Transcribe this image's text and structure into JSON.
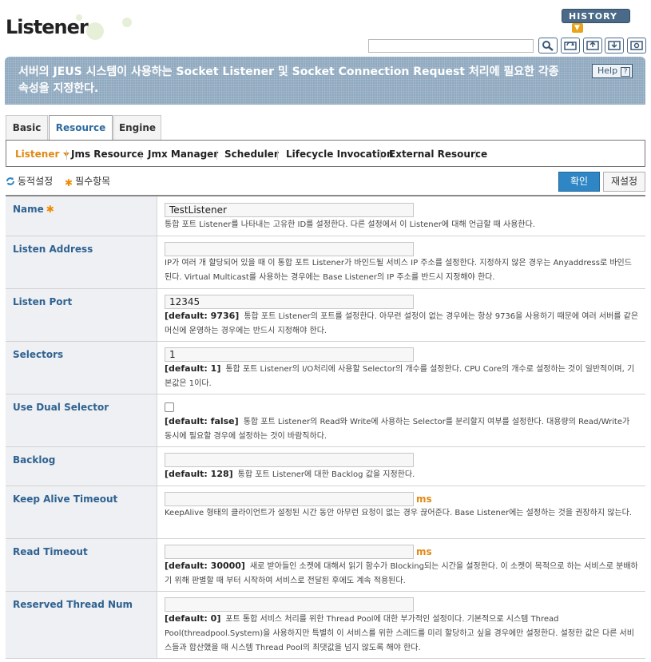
{
  "header": {
    "title": "Listener",
    "history_label": "HISTORY",
    "search_value": "",
    "tools": [
      "search-icon",
      "refresh-icon",
      "xml-export-icon",
      "xml-import-icon",
      "settings-icon"
    ]
  },
  "banner": {
    "text": "서버의 JEUS 시스템이 사용하는 Socket Listener 및 Socket Connection Request 처리에 필요한 각종 속성을 지정한다.",
    "help_label": "Help",
    "help_icon_text": "?"
  },
  "tabs": [
    {
      "label": "Basic",
      "active": false
    },
    {
      "label": "Resource",
      "active": true
    },
    {
      "label": "Engine",
      "active": false
    }
  ],
  "subnav": [
    {
      "label": "Listener",
      "active": true
    },
    {
      "label": "Jms Resource",
      "active": false
    },
    {
      "label": "Jmx Manager",
      "active": false
    },
    {
      "label": "Scheduler",
      "active": false
    },
    {
      "label": "Lifecycle Invocation",
      "active": false
    },
    {
      "label": "External Resource",
      "active": false
    }
  ],
  "legend": {
    "dynamic_label": "동적설정",
    "required_label": "필수항목",
    "required_mark": "✱"
  },
  "actions": {
    "ok_label": "확인",
    "reset_label": "재설정"
  },
  "fields": [
    {
      "label": "Name",
      "required": true,
      "value": "TestListener",
      "unit": "",
      "default": "",
      "desc": "통합 포트 Listener를 나타내는 고유한 ID를 설정한다. 다른 설정에서 이 Listener에 대해 언급할 때 사용한다."
    },
    {
      "label": "Listen Address",
      "required": false,
      "value": "",
      "unit": "",
      "default": "",
      "desc": "IP가 여러 개 할당되어 있을 때 이 통합 포트 Listener가 바인드될 서비스 IP 주소를 설정한다. 지정하지 않은 경우는 Anyaddress로 바인드된다. Virtual Multicast를 사용하는 경우에는 Base Listener의 IP 주소를 반드시 지정해야 한다."
    },
    {
      "label": "Listen Port",
      "required": false,
      "value": "12345",
      "unit": "",
      "default": "[default: 9736]",
      "desc": "통합 포트 Listener의 포트를 설정한다. 아무런 설정이 없는 경우에는 항상 9736을 사용하기 때문에 여러 서버를 같은 머신에 운영하는 경우에는 반드시 지정해야 한다."
    },
    {
      "label": "Selectors",
      "required": false,
      "value": "1",
      "unit": "",
      "default": "[default: 1]",
      "desc": "통합 포트 Listener의 I/O처리에 사용할 Selector의 개수를 설정한다. CPU Core의 개수로 설정하는 것이 일반적이며, 기본값은 1이다."
    },
    {
      "label": "Use Dual Selector",
      "required": false,
      "value": "",
      "unit": "",
      "default": "[default: false]",
      "desc": "통합 포트 Listener의 Read와 Write에 사용하는 Selector를 분리할지 여부를 설정한다. 대용량의 Read/Write가 동시에 필요할 경우에 설정하는 것이 바람직하다."
    },
    {
      "label": "Backlog",
      "required": false,
      "value": "",
      "unit": "",
      "default": "[default: 128]",
      "desc": "통합 포트 Listener에 대한 Backlog 값을 지정한다."
    },
    {
      "label": "Keep Alive Timeout",
      "required": false,
      "value": "",
      "unit": "ms",
      "default": "",
      "desc": "KeepAlive 형태의 클라이언트가 설정된 시간 동안 아무런 요청이 없는 경우 끊어준다. Base Listener에는 설정하는 것을 권장하지 않는다."
    },
    {
      "label": "Read Timeout",
      "required": false,
      "value": "",
      "unit": "ms",
      "default": "[default: 30000]",
      "desc": "새로 받아들인 소켓에 대해서 읽기 함수가 Blocking되는 시간을 설정한다. 이 소켓이 목적으로 하는 서비스로 분배하기 위해 판별할 때 부터 시작하여 서비스로 전달된 후에도 계속 적용된다."
    },
    {
      "label": "Reserved Thread Num",
      "required": false,
      "value": "",
      "unit": "",
      "default": "[default: 0]",
      "desc": "포트 통합 서비스 처리를 위한 Thread Pool에 대한 부가적인 설정이다. 기본적으로 시스템 Thread Pool(threadpool.System)을 사용하지만 특별히 이 서비스를 위한 스레드를 미리 할당하고 싶을 경우에만 설정한다. 설정한 값은 다른 서비스들과 합산했을 때 시스템 Thread Pool의 최댓값을 넘지 않도록 해야 한다."
    }
  ]
}
